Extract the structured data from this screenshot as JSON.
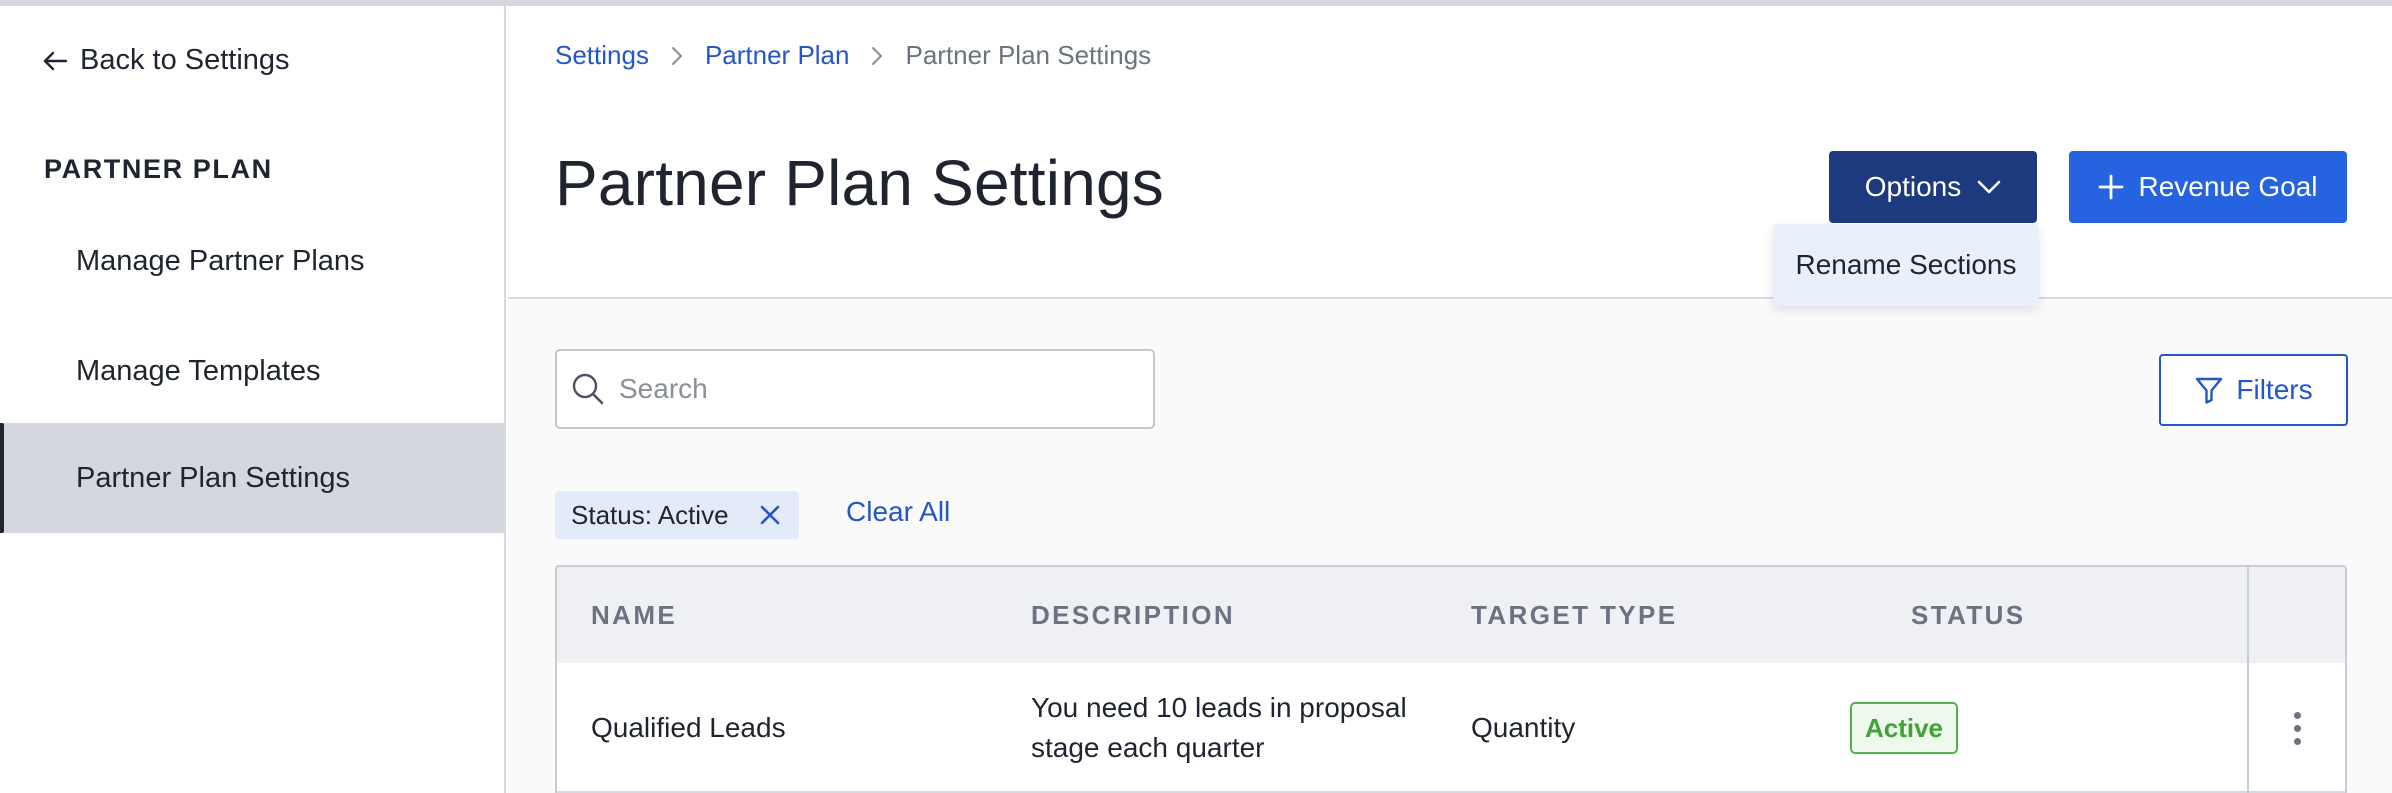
{
  "sidebar": {
    "back_label": "Back to Settings",
    "heading": "PARTNER PLAN",
    "items": [
      {
        "label": "Manage Partner Plans"
      },
      {
        "label": "Manage Templates"
      },
      {
        "label": "Partner Plan Settings",
        "active": true
      }
    ]
  },
  "breadcrumb": [
    "Settings",
    "Partner Plan",
    "Partner Plan Settings"
  ],
  "header": {
    "title": "Partner Plan Settings",
    "options_label": "Options",
    "revenue_goal_label": "Revenue Goal"
  },
  "options_menu": {
    "items": [
      "Rename Sections"
    ]
  },
  "search": {
    "placeholder": "Search",
    "value": ""
  },
  "filters_label": "Filters",
  "active_filters": [
    {
      "label": "Status: Active"
    }
  ],
  "clear_all_label": "Clear All",
  "table": {
    "columns": [
      "NAME",
      "DESCRIPTION",
      "TARGET TYPE",
      "STATUS"
    ],
    "rows": [
      {
        "name": "Qualified Leads",
        "description_line1": "You need 10 leads in proposal",
        "description_line2": "stage each quarter",
        "target_type": "Quantity",
        "status": "Active"
      }
    ]
  },
  "colors": {
    "primary": "#2563e0",
    "primary_dark": "#1d3a7e",
    "link": "#2456c8",
    "status_active": "#3fa338"
  }
}
